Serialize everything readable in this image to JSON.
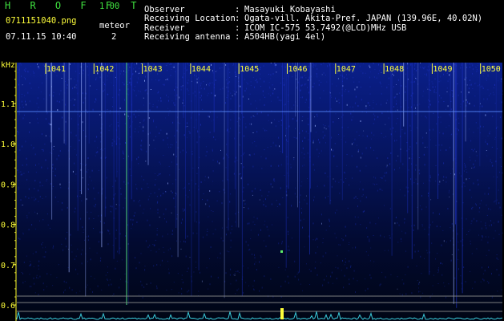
{
  "app": {
    "title": "H R O F F T",
    "version": "1.00",
    "filename": "0711151040.png",
    "datetime": "07.11.15 10:40",
    "meteor_label": "meteor",
    "meteor_count": "2"
  },
  "info": [
    {
      "label": "Observer",
      "value": "Masayuki Kobayashi"
    },
    {
      "label": "Receiving Location",
      "value": "Ogata-vill. Akita-Pref. JAPAN (139.96E, 40.02N)"
    },
    {
      "label": "Receiver",
      "value": "ICOM IC-575 53.7492(@LCD)MHz USB"
    },
    {
      "label": "Receiving antenna",
      "value": "A504HB(yagi 4el)"
    }
  ],
  "separator": ":",
  "colors": {
    "title": "#3fe03f",
    "filename": "#ffff3a",
    "axis_labels": "#ffff3a",
    "background_low": "#000814",
    "signal_dim": "#1a2fb8",
    "signal_bright": "#9ab0ff",
    "baseline_trace": "#40e0f0"
  },
  "chart_data": {
    "type": "heatmap",
    "y_unit_label": "kHz",
    "x_tick_labels": [
      "1041",
      "1042",
      "1043",
      "1044",
      "1045",
      "1046",
      "1047",
      "1048",
      "1049",
      "1050"
    ],
    "y_tick_labels": [
      "1.1",
      "1.0",
      "0.9",
      "0.8",
      "0.7",
      "0.6"
    ],
    "y_ticks": [
      1.1,
      1.0,
      0.9,
      0.8,
      0.7,
      0.6
    ],
    "ylim": [
      0.58,
      1.2
    ],
    "horizontal_line_khz": 1.08
  }
}
